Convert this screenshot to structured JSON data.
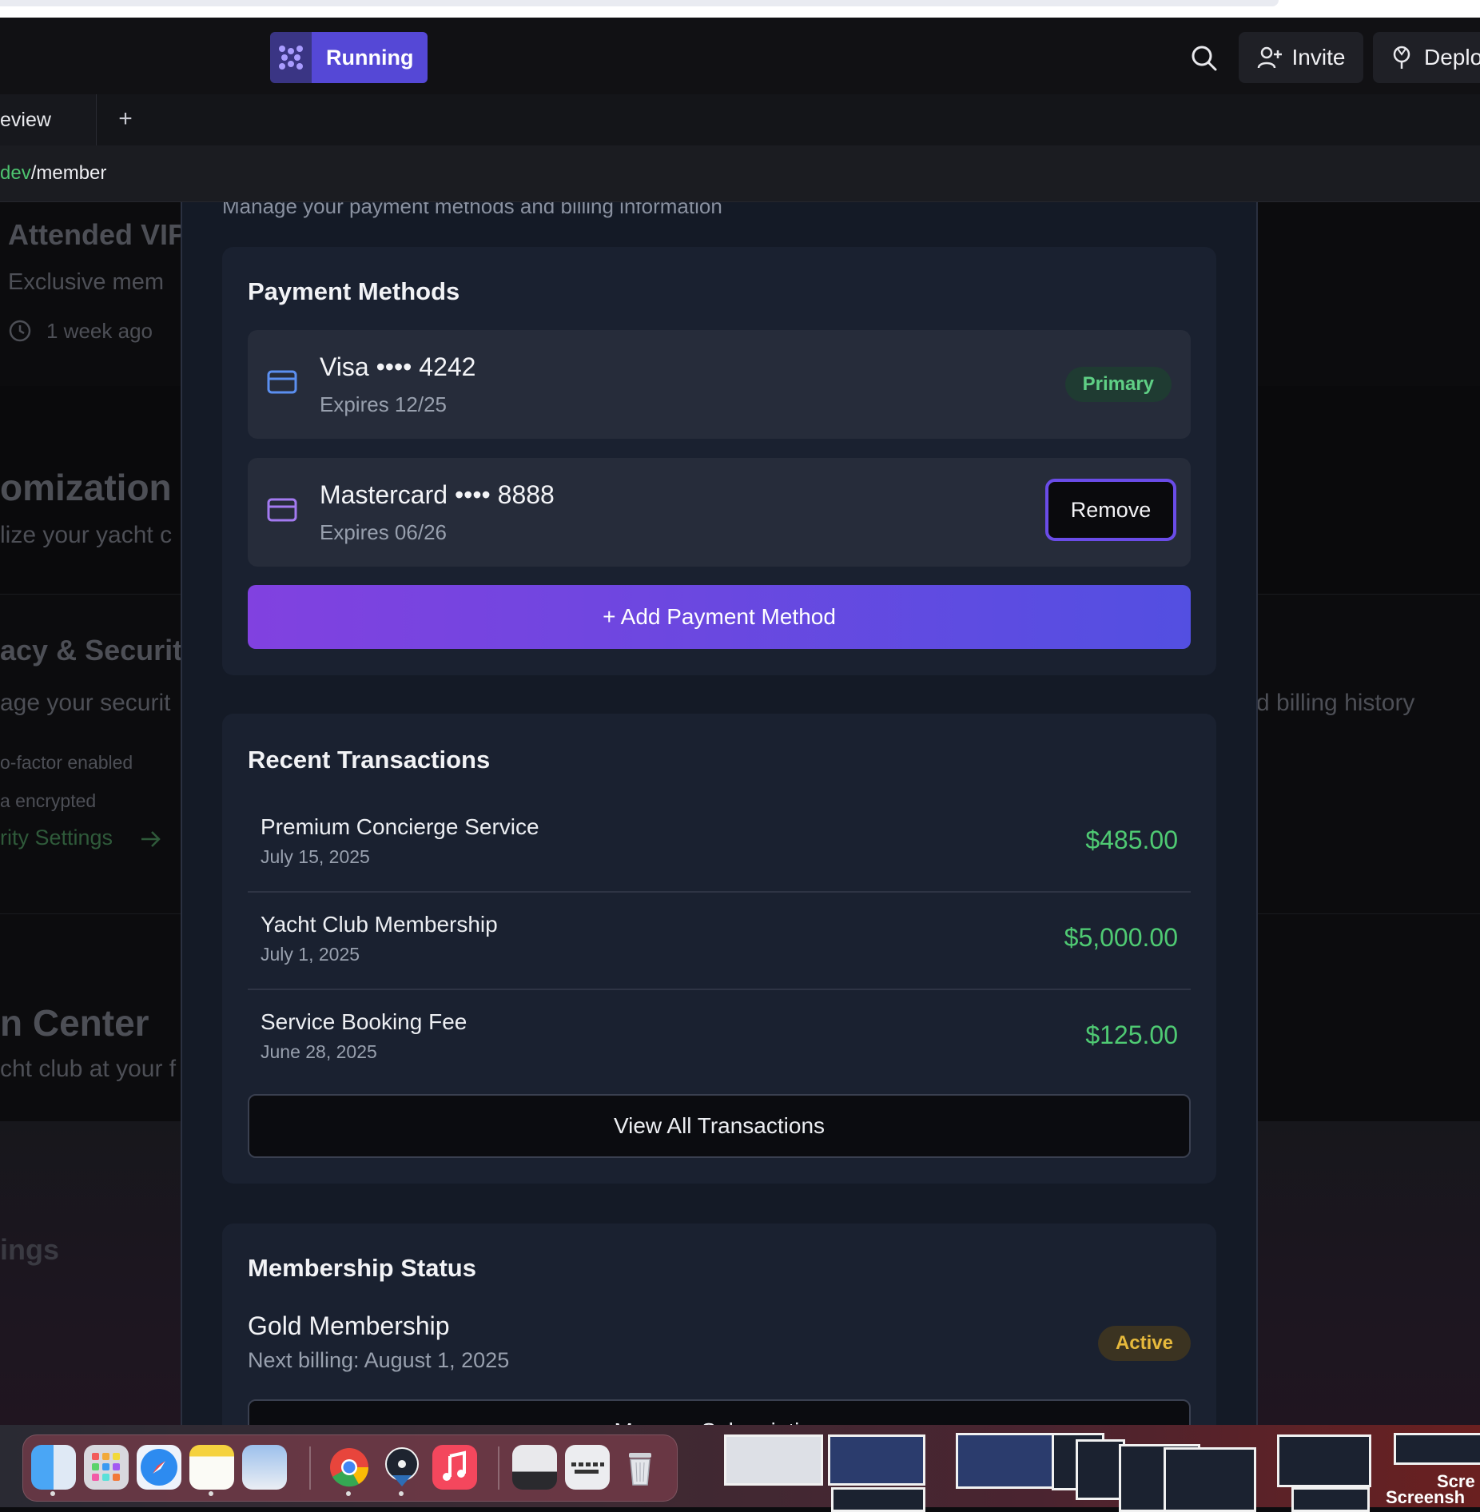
{
  "appbar": {
    "run_label": "Running",
    "invite_label": "Invite",
    "deploy_label": "Deplo"
  },
  "tabs": {
    "active_label": "eview",
    "add_label": "+"
  },
  "url": {
    "host_part": "dev",
    "path_part": "/member"
  },
  "background": {
    "s1_title": "Attended VIP",
    "s1_sub": "Exclusive mem",
    "s1_time": "1 week ago",
    "s2_title": "omization P",
    "s2_sub": "lize your yacht c",
    "s3_title": "acy & Securit",
    "s3_sub": "age your securit",
    "s3_right": "d billing history",
    "s3_item1": "o-factor enabled",
    "s3_item2": "a encrypted",
    "s3_link": "rity Settings",
    "s4_title": "n Center",
    "s4_sub": "cht club at your f",
    "s5_title": "ings"
  },
  "modal": {
    "subtitle": "Manage your payment methods and billing information",
    "payment_methods": {
      "title": "Payment Methods",
      "cards": [
        {
          "name": "Visa •••• 4242",
          "expires": "Expires 12/25",
          "badge": "Primary"
        },
        {
          "name": "Mastercard •••• 8888",
          "expires": "Expires 06/26",
          "action": "Remove"
        }
      ],
      "add_label": "+ Add Payment Method"
    },
    "transactions": {
      "title": "Recent Transactions",
      "items": [
        {
          "name": "Premium Concierge Service",
          "date": "July 15, 2025",
          "amount": "$485.00"
        },
        {
          "name": "Yacht Club Membership",
          "date": "July 1, 2025",
          "amount": "$5,000.00"
        },
        {
          "name": "Service Booking Fee",
          "date": "June 28, 2025",
          "amount": "$125.00"
        }
      ],
      "view_all_label": "View All Transactions"
    },
    "membership": {
      "title": "Membership Status",
      "plan": "Gold Membership",
      "next_billing": "Next billing: August 1, 2025",
      "status": "Active",
      "manage_label": "Manage Subscription"
    }
  },
  "colors": {
    "accent": "#5548d6",
    "positive": "#4fca73",
    "gold": "#e6b93c"
  },
  "dock": {
    "apps": [
      "finder-icon",
      "launchpad-icon",
      "safari-icon",
      "notes-icon",
      "preview-icon",
      "chrome-icon",
      "app-icon",
      "music-icon",
      "scanner-icon",
      "keyboard-icon",
      "trash-icon"
    ],
    "thumb_label": "Scre",
    "thumb_label2": "Screensh"
  }
}
